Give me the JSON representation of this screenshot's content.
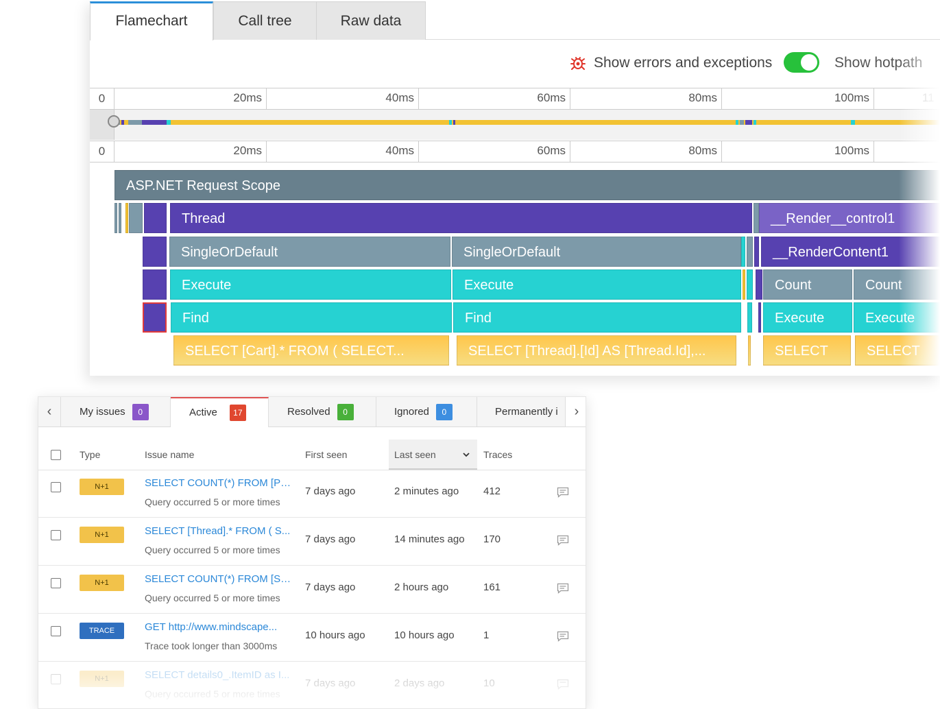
{
  "flamechart": {
    "tabs": [
      {
        "label": "Flamechart",
        "active": true
      },
      {
        "label": "Call tree",
        "active": false
      },
      {
        "label": "Raw data",
        "active": false
      }
    ],
    "show_errors_label": "Show errors and exceptions",
    "show_errors_enabled": true,
    "show_hotpath_label": "Show hotpath",
    "ruler": {
      "zero": "0",
      "ticks": [
        "20ms",
        "40ms",
        "60ms",
        "80ms",
        "100ms",
        "11"
      ]
    },
    "blocks": {
      "scope": "ASP.NET Request Scope",
      "thread": "Thread",
      "render_control": "__Render__control1",
      "single_1": "SingleOrDefault",
      "single_2": "SingleOrDefault",
      "render_content": "__RenderContent1",
      "execute_1": "Execute",
      "execute_2": "Execute",
      "count_1": "Count",
      "count_2": "Count",
      "find_1": "Find",
      "find_2": "Find",
      "execute_3": "Execute",
      "execute_4": "Execute",
      "sql_1": "SELECT    [Cart].*  FROM    (     SELECT...",
      "sql_2": "SELECT    [Thread].[Id] AS [Thread.Id],...",
      "sql_3": "SELECT",
      "sql_4": "SELECT"
    }
  },
  "issues": {
    "tabs": [
      {
        "label": "My issues",
        "count": "0",
        "color": "#8a56c9"
      },
      {
        "label": "Active",
        "count": "17",
        "color": "#e0472f",
        "active": true
      },
      {
        "label": "Resolved",
        "count": "0",
        "color": "#49b03a"
      },
      {
        "label": "Ignored",
        "count": "0",
        "color": "#3d8ee0"
      },
      {
        "label": "Permanently i",
        "count": null
      }
    ],
    "columns": {
      "type": "Type",
      "name": "Issue name",
      "first_seen": "First seen",
      "last_seen": "Last seen",
      "traces": "Traces"
    },
    "rows": [
      {
        "type": "N+1",
        "name": "SELECT COUNT(*) FROM [Po...",
        "sub": "Query occurred 5 or more times",
        "first": "7 days ago",
        "last": "2 minutes ago",
        "traces": "412"
      },
      {
        "type": "N+1",
        "name": "SELECT [Thread].* FROM ( S...",
        "sub": "Query occurred 5 or more times",
        "first": "7 days ago",
        "last": "14 minutes ago",
        "traces": "170"
      },
      {
        "type": "N+1",
        "name": "SELECT COUNT(*) FROM [Su...",
        "sub": "Query occurred 5 or more times",
        "first": "7 days ago",
        "last": "2 hours ago",
        "traces": "161"
      },
      {
        "type": "TRACE",
        "name": "GET http://www.mindscape...",
        "sub": "Trace took longer than 3000ms",
        "first": "10 hours ago",
        "last": "10 hours ago",
        "traces": "1"
      },
      {
        "type": "N+1",
        "name": "SELECT details0_.ItemID as I...",
        "sub": "Query occurred 5 or more times",
        "first": "7 days ago",
        "last": "2 days ago",
        "traces": "10"
      }
    ]
  }
}
